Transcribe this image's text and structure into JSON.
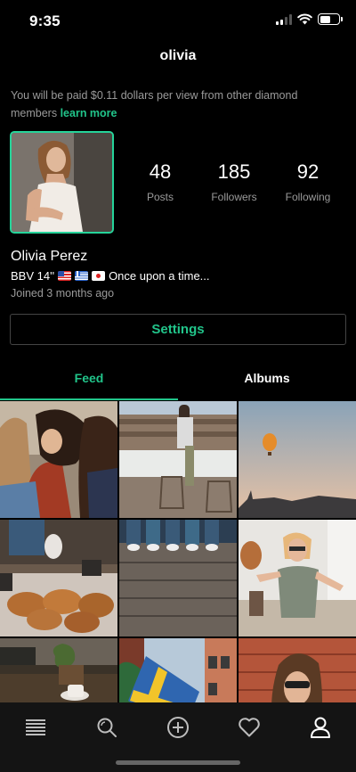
{
  "status_bar": {
    "time": "9:35"
  },
  "header": {
    "title": "olivia"
  },
  "payout": {
    "text": "You will be paid $0.11 dollars per view from other diamond members ",
    "link": "learn more"
  },
  "profile": {
    "stats": [
      {
        "value": "48",
        "label": "Posts"
      },
      {
        "value": "185",
        "label": "Followers"
      },
      {
        "value": "92",
        "label": "Following"
      }
    ],
    "name": "Olivia Perez",
    "bio_prefix": "BBV 14''",
    "bio_flags": [
      "flag-us",
      "flag-greece",
      "flag-japan"
    ],
    "bio_text": "Once upon a time...",
    "joined": "Joined 3 months ago"
  },
  "settings_button": "Settings",
  "tabs": [
    {
      "label": "Feed",
      "active": true
    },
    {
      "label": "Albums",
      "active": false
    }
  ],
  "feed_photos": [
    "photo-friends-laughing",
    "photo-balcony-chairs",
    "photo-hot-air-balloon",
    "photo-cinnamon-buns",
    "photo-feet-on-deck",
    "photo-woman-with-hat",
    "photo-plant-and-coffee",
    "photo-swedish-flag-street",
    "photo-woman-brick-wall"
  ],
  "bottom_nav": [
    {
      "icon": "feed-list-icon",
      "active": false
    },
    {
      "icon": "search-icon",
      "active": false
    },
    {
      "icon": "add-post-icon",
      "active": false
    },
    {
      "icon": "heart-icon",
      "active": false
    },
    {
      "icon": "profile-icon",
      "active": true
    }
  ],
  "colors": {
    "accent": "#21c48a",
    "avatar_border": "#26d49a",
    "background": "#000000",
    "tabbar": "#141414",
    "muted_text": "#9a9a9a"
  }
}
